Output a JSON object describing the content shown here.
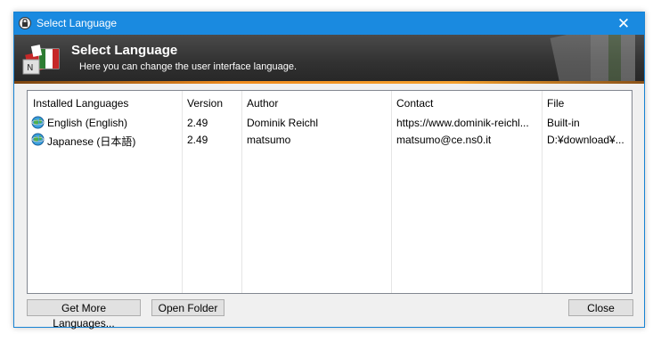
{
  "window": {
    "title": "Select Language",
    "close_symbol": "✕"
  },
  "banner": {
    "heading": "Select Language",
    "subtitle": "Here you can change the user interface language."
  },
  "table": {
    "columns": [
      "Installed Languages",
      "Version",
      "Author",
      "Contact",
      "File"
    ],
    "rows": [
      {
        "language": "English (English)",
        "version": "2.49",
        "author": "Dominik Reichl",
        "contact": "https://www.dominik-reichl...",
        "file": "Built-in",
        "icon": "globe-icon"
      },
      {
        "language": "Japanese (日本語)",
        "version": "2.49",
        "author": "matsumo",
        "contact": "matsumo@ce.ns0.it",
        "file": "D:¥download¥...",
        "icon": "globe-icon"
      }
    ]
  },
  "buttons": {
    "get_more": "Get More Languages...",
    "open_folder": "Open Folder",
    "close": "Close"
  },
  "colors": {
    "titlebar": "#1a8ae0",
    "banner_accent": "#f08c1e"
  }
}
